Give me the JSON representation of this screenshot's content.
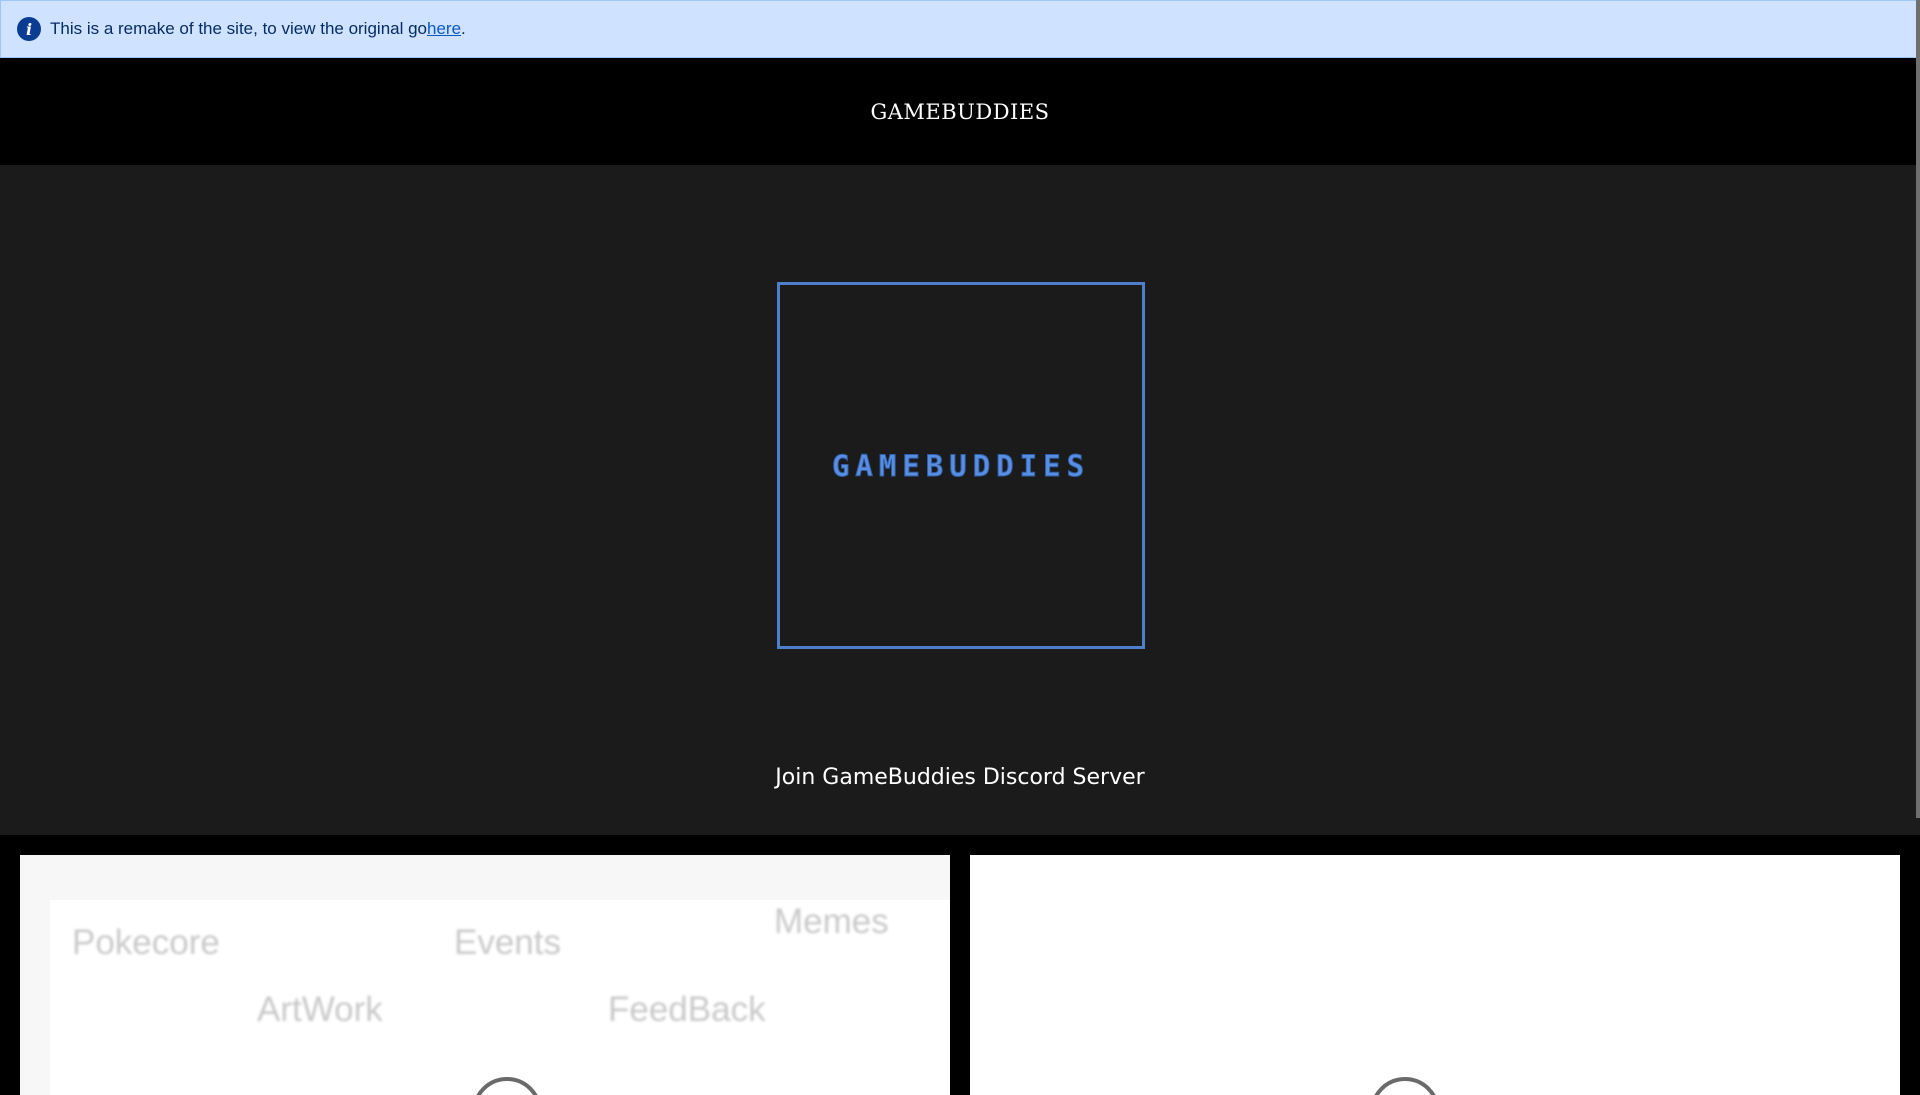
{
  "banner": {
    "message": "This is a remake of the site, to view the original go ",
    "link_text": "here",
    "trailing": "."
  },
  "header": {
    "title": "GAMEBUDDIES"
  },
  "hero": {
    "logo_text": "GAMEBUDDIES",
    "discord_link": "Join GameBuddies Discord Server"
  },
  "cards": {
    "left": {
      "tags": [
        "Pokecore",
        "Events",
        "Memes",
        "ArtWork",
        "FeedBack"
      ]
    }
  },
  "colors": {
    "banner_bg": "#cfe2ff",
    "hero_bg": "#1b1b1c",
    "logo_accent": "#4f7fcb"
  },
  "icons": {
    "banner_icon": "info-icon"
  }
}
